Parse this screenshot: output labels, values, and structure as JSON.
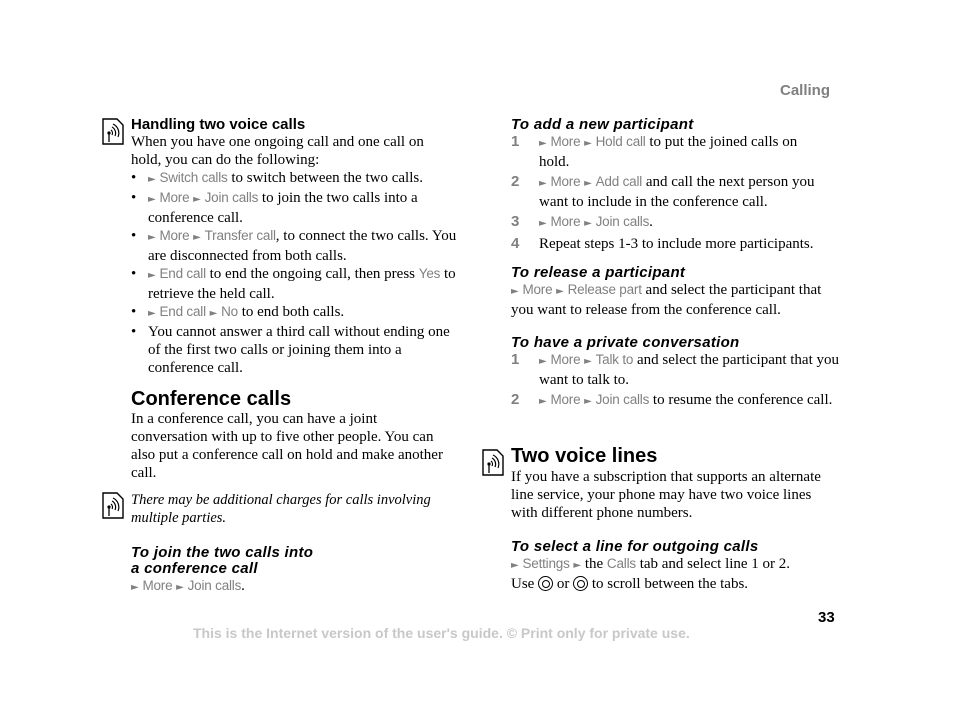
{
  "header": {
    "section": "Calling"
  },
  "left": {
    "handling": {
      "title": "Handling two voice calls",
      "intro": "When you have one ongoing call and one call on hold, you can do the following:",
      "bullets": [
        {
          "m1": "Switch calls",
          "rest": " to switch between the two calls."
        },
        {
          "m1": "More",
          "m2": "Join calls",
          "rest": " to join the two calls into a conference call."
        },
        {
          "m1": "More",
          "m2": "Transfer call",
          "rest": ", to connect the two calls. You are disconnected from both calls."
        },
        {
          "m1": "End call",
          "rest_a": " to end the ongoing call, then press ",
          "key": "Yes",
          "rest_b": " to retrieve the held call."
        },
        {
          "m1": "End call",
          "m2": "No",
          "rest": " to end both calls."
        },
        {
          "text": "You cannot answer a third call without ending one of the first two calls or joining them into a conference call."
        }
      ]
    },
    "conference": {
      "title": "Conference calls",
      "body": "In a conference call, you can have a joint conversation with up to five other people. You can also put a conference call on hold and make another call.",
      "note": "There may be additional charges for calls involving multiple parties."
    },
    "join": {
      "title_line1": "To join the two calls into",
      "title_line2": "a conference call",
      "m1": "More",
      "m2": "Join calls",
      "end": "."
    }
  },
  "right": {
    "add": {
      "title": "To add a new participant",
      "steps": [
        {
          "n": "1",
          "m1": "More",
          "m2": "Hold call",
          "rest": " to put the joined calls on hold."
        },
        {
          "n": "2",
          "m1": "More",
          "m2": "Add call",
          "rest": " and call the next person you want to include in the conference call."
        },
        {
          "n": "3",
          "m1": "More",
          "m2": "Join calls",
          "rest": "."
        },
        {
          "n": "4",
          "text": "Repeat steps 1-3 to include more participants."
        }
      ]
    },
    "release": {
      "title": "To release a participant",
      "m1": "More",
      "m2": "Release part",
      "rest": " and select the participant that you want to release from the conference call."
    },
    "private": {
      "title": "To have a private conversation",
      "steps": [
        {
          "n": "1",
          "m1": "More",
          "m2": "Talk to",
          "rest": " and select the participant that you want to talk to."
        },
        {
          "n": "2",
          "m1": "More",
          "m2": "Join calls",
          "rest": " to resume the conference call."
        }
      ]
    },
    "two_lines": {
      "title": "Two voice lines",
      "body": "If you have a subscription that supports an alternate line service, your phone may have two voice lines with different phone numbers."
    },
    "select_line": {
      "title": "To select a line for outgoing calls",
      "m1": "Settings",
      "mid": " the ",
      "m2": "Calls",
      "rest": " tab and select line 1 or 2.",
      "use": "Use ",
      "or": " or ",
      "scroll": " to scroll between the tabs."
    }
  },
  "footer": {
    "page_number": "33",
    "notice": "This is the Internet version of the user's guide. © Print only for private use."
  },
  "icons": {
    "arrow": "►"
  }
}
